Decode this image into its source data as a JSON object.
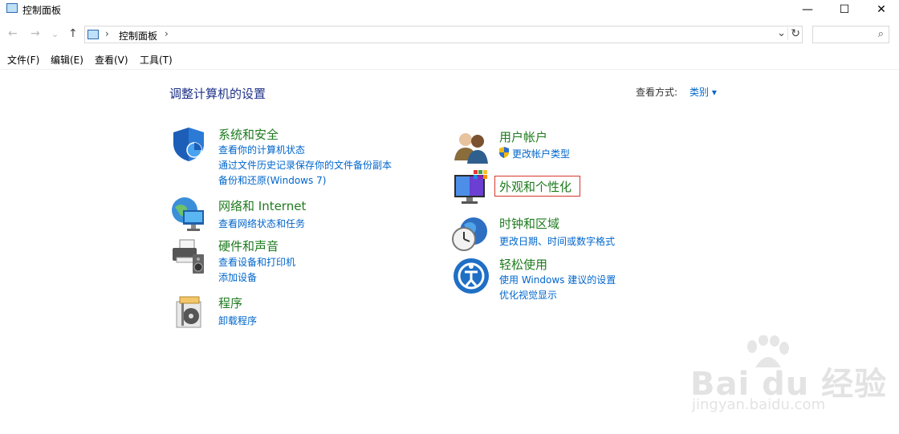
{
  "window": {
    "title": "控制面板",
    "buttons": {
      "minimize": "—",
      "maximize": "☐",
      "close": "✕"
    }
  },
  "nav": {
    "back": "←",
    "forward": "→",
    "recent": "⌄",
    "up": "↑"
  },
  "address": {
    "sep1": "›",
    "crumb": "控制面板",
    "sep2": "›",
    "dropdown": "⌄",
    "refresh": "↻"
  },
  "search": {
    "placeholder": "",
    "icon": "⌕"
  },
  "menu": [
    "文件(F)",
    "编辑(E)",
    "查看(V)",
    "工具(T)"
  ],
  "main": {
    "heading": "调整计算机的设置",
    "view_by_label": "查看方式:",
    "view_by_value": "类别 ▾"
  },
  "categories_left": [
    {
      "title": "系统和安全",
      "icon": "shield-icon",
      "links": [
        "查看你的计算机状态",
        "通过文件历史记录保存你的文件备份副本",
        "备份和还原(Windows 7)"
      ]
    },
    {
      "title": "网络和 Internet",
      "icon": "network-icon",
      "links": [
        "查看网络状态和任务"
      ]
    },
    {
      "title": "硬件和声音",
      "icon": "printer-icon",
      "links": [
        "查看设备和打印机",
        "添加设备"
      ]
    },
    {
      "title": "程序",
      "icon": "programs-icon",
      "links": [
        "卸载程序"
      ]
    }
  ],
  "categories_right": [
    {
      "title": "用户帐户",
      "icon": "users-icon",
      "links": [
        "更改帐户类型"
      ]
    },
    {
      "title": "外观和个性化",
      "icon": "monitor-icon",
      "links": []
    },
    {
      "title": "时钟和区域",
      "icon": "clock-icon",
      "links": [
        "更改日期、时间或数字格式"
      ]
    },
    {
      "title": "轻松使用",
      "icon": "accessibility-icon",
      "links": [
        "使用 Windows 建议的设置",
        "优化视觉显示"
      ]
    }
  ],
  "watermark": {
    "text": "Bai du 经验",
    "sub": "jingyan.baidu.com"
  },
  "colors": {
    "heading": "#1e3287",
    "category": "#1e7b1e",
    "link": "#0066cc",
    "highlight": "#d9362c"
  }
}
